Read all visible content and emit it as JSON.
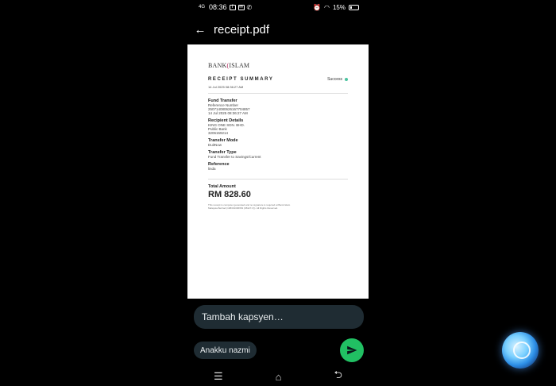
{
  "status_bar": {
    "network": "4G",
    "time": "08:36",
    "battery": "15%"
  },
  "header": {
    "title": "receipt.pdf"
  },
  "receipt": {
    "logo_text": "BANKISLAM",
    "summary_title": "RECEIPT SUMMARY",
    "status": "Success",
    "date": "14 Jul 2025 08:36:27 AM",
    "sections": [
      {
        "title": "Fund Transfer",
        "lines": [
          "Reference Number",
          "250714080626167704857",
          "14 Jul 2025 08:36:27 AM"
        ]
      },
      {
        "title": "Recipient Details",
        "lines": [
          "KING ONE SDN. BHD.",
          "Public Bank",
          "3206159214"
        ]
      },
      {
        "title": "Transfer Mode",
        "lines": [
          "DuitNow"
        ]
      },
      {
        "title": "Transfer Type",
        "lines": [
          "Fund Transfer to Savings/Current"
        ]
      },
      {
        "title": "Reference",
        "lines": [
          "linda"
        ]
      }
    ],
    "total_label": "Total Amount",
    "total_value": "RM 828.60",
    "fine_print": "This receipt is computer generated and no signature is required at Bank Islam Malaysia Berhad (198301006654 (98127-X)). All Rights Reserved."
  },
  "caption": {
    "placeholder": "Tambah kapsyen…"
  },
  "recipient": {
    "label": "Anakku nazmi"
  },
  "colors": {
    "send_button": "#21c063",
    "status_dot": "#4cc39f",
    "caption_bg": "#1f2c33"
  },
  "icons": {
    "back": "arrow-left-icon",
    "send": "send-icon",
    "nav_menu": "menu-icon",
    "nav_home": "home-icon",
    "nav_back": "return-icon"
  }
}
